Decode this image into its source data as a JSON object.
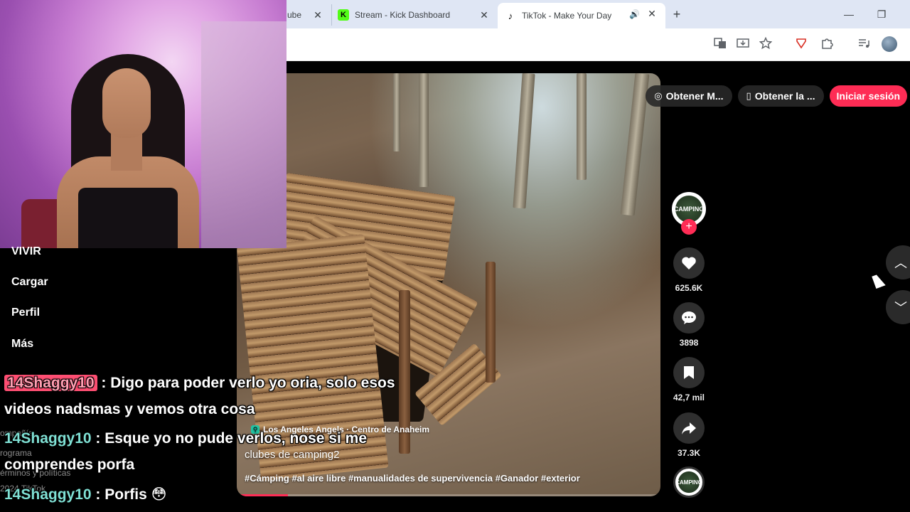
{
  "browser": {
    "tabs": [
      {
        "title": "ube",
        "close": "✕"
      },
      {
        "title": "Stream - Kick Dashboard",
        "favicon": "K",
        "close": "✕"
      },
      {
        "title": "TikTok - Make Your Day",
        "favicon": "♪",
        "speaker": "🔊",
        "close": "✕"
      }
    ],
    "new_tab": "+",
    "window_controls": {
      "minimize": "—",
      "restore": "❐",
      "close": "✕"
    },
    "toolbar_icons": [
      "translate-icon",
      "install-icon",
      "star-icon",
      "extension-red-icon",
      "puzzle-icon",
      "media-icon",
      "profile-icon"
    ]
  },
  "tiktok": {
    "top_buttons": {
      "get_app_1": "Obtener M...",
      "get_app_2": "Obtener la ...",
      "login": "Iniciar sesión"
    },
    "video": {
      "location": "Los Angeles Angels · Centro de Anaheim",
      "caption": "clubes de camping2",
      "hashtags": "#Cámping #al aire libre #manualidades de supervivencia #Ganador #exterior",
      "progress": 0.12
    },
    "creator_label": "CAMPING",
    "actions": {
      "likes": "625.6K",
      "comments": "3898",
      "saves": "42,7 mil",
      "shares": "37.3K"
    },
    "nav": {
      "up": "︿",
      "down": "﹀"
    },
    "accent": "#fe2c55"
  },
  "overlay": {
    "menu": [
      "VIVIR",
      "Cargar",
      "Perfil",
      "Más"
    ],
    "ghost_text": [
      "ompañía",
      "rograma",
      "érminos y políticas",
      "2024 TikTok"
    ],
    "chat": [
      {
        "user": "14Shaggy10",
        "sep": " : ",
        "msg": "Digo para poder verlo yo oria, solo esos"
      },
      {
        "user": "",
        "sep": "",
        "msg": "videos nadsmas y vemos otra cosa"
      },
      {
        "user": "14Shaggy10",
        "sep": " : ",
        "msg": "Esque yo no pude verlos, nose si me"
      },
      {
        "user": "",
        "sep": "",
        "msg": "comprendes porfa"
      },
      {
        "user": "14Shaggy10",
        "sep": " : ",
        "msg": "Porfis 😳"
      }
    ]
  }
}
